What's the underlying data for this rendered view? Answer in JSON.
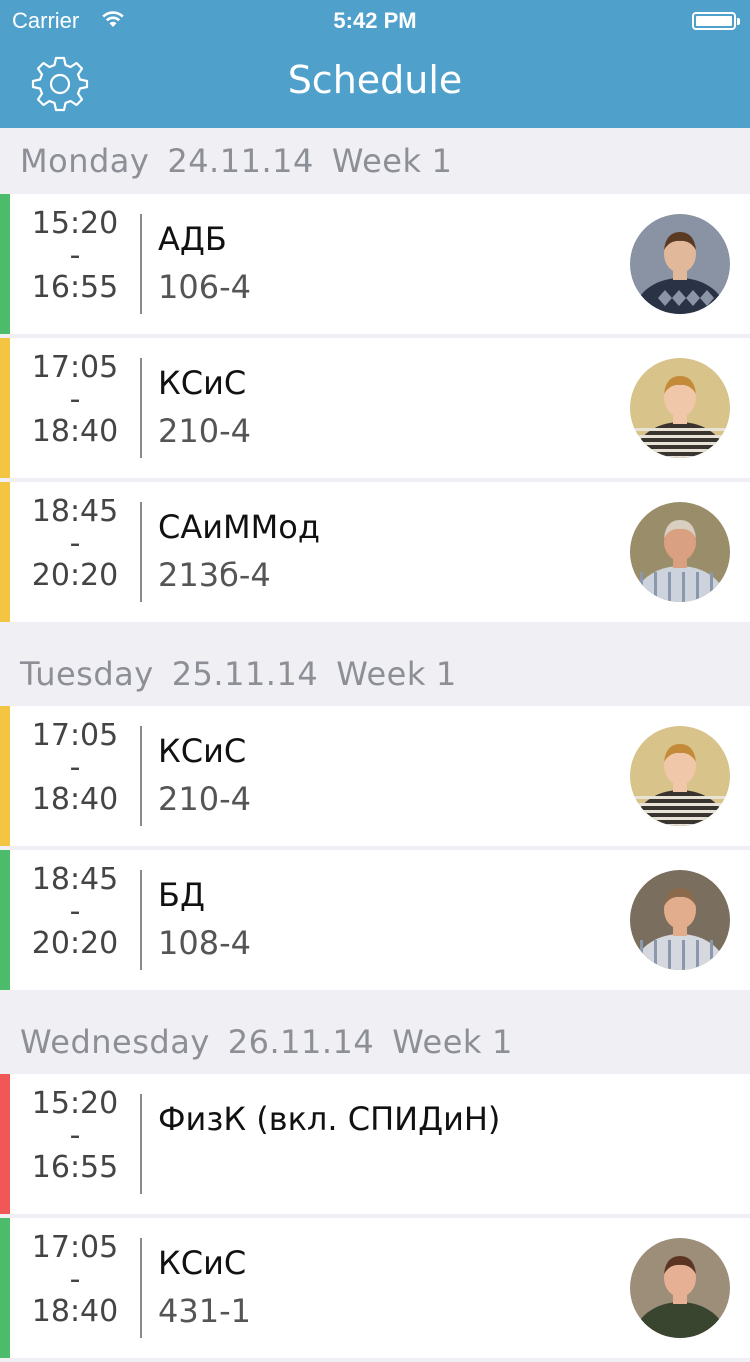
{
  "status_bar": {
    "carrier": "Carrier",
    "time": "5:42 PM"
  },
  "header": {
    "title": "Schedule"
  },
  "colors": {
    "header": "#4fa1cc",
    "green": "#4cbb6a",
    "yellow": "#f4c542",
    "red": "#f25757"
  },
  "days": [
    {
      "day": "Monday",
      "date": "24.11.14",
      "week_label": "Week",
      "week": "1",
      "lessons": [
        {
          "start": "15:20",
          "sep": "-",
          "end": "16:55",
          "subject": "АДБ",
          "room": "106-4",
          "color": "#4cbb6a",
          "avatar": "teacher-1"
        },
        {
          "start": "17:05",
          "sep": "-",
          "end": "18:40",
          "subject": "КСиС",
          "room": "210-4",
          "color": "#f4c542",
          "avatar": "teacher-2"
        },
        {
          "start": "18:45",
          "sep": "-",
          "end": "20:20",
          "subject": "САиММод",
          "room": "213б-4",
          "color": "#f4c542",
          "avatar": "teacher-3"
        }
      ]
    },
    {
      "day": "Tuesday",
      "date": "25.11.14",
      "week_label": "Week",
      "week": "1",
      "lessons": [
        {
          "start": "17:05",
          "sep": "-",
          "end": "18:40",
          "subject": "КСиС",
          "room": "210-4",
          "color": "#f4c542",
          "avatar": "teacher-2"
        },
        {
          "start": "18:45",
          "sep": "-",
          "end": "20:20",
          "subject": "БД",
          "room": "108-4",
          "color": "#4cbb6a",
          "avatar": "teacher-4"
        }
      ]
    },
    {
      "day": "Wednesday",
      "date": "26.11.14",
      "week_label": "Week",
      "week": "1",
      "lessons": [
        {
          "start": "15:20",
          "sep": "-",
          "end": "16:55",
          "subject": "ФизК (вкл. СПИДиН)",
          "room": "",
          "color": "#f25757",
          "avatar": ""
        },
        {
          "start": "17:05",
          "sep": "-",
          "end": "18:40",
          "subject": "КСиС",
          "room": "431-1",
          "color": "#4cbb6a",
          "avatar": "teacher-5"
        }
      ]
    }
  ]
}
